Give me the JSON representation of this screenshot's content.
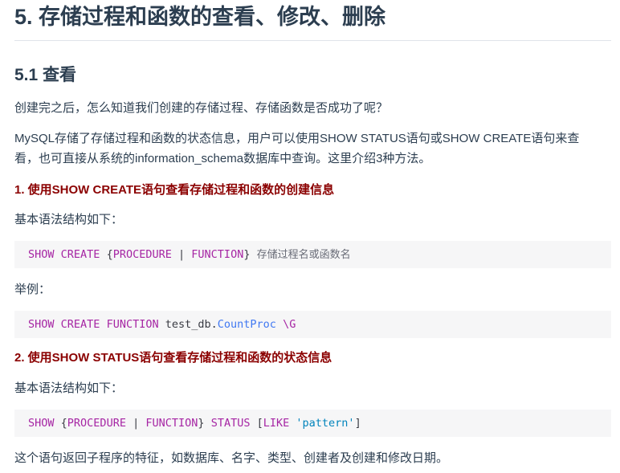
{
  "heading1": "5. 存储过程和函数的查看、修改、删除",
  "heading2": "5.1 查看",
  "intro_question": "创建完之后，怎么知道我们创建的存储过程、存储函数是否成功了呢？",
  "intro_line1": "MySQL存储了存储过程和函数的状态信息，用户可以使用SHOW STATUS语句或SHOW CREATE语句来查",
  "intro_line2": "看，也可直接从系统的information_schema数据库中查询。这里介绍3种方法。",
  "method1": {
    "title": "1. 使用SHOW CREATE语句查看存储过程和函数的创建信息",
    "syntax_label": "基本语法结构如下：",
    "syntax_code": {
      "kw1": "SHOW",
      "kw2": "CREATE",
      "open": "{",
      "kw3": "PROCEDURE",
      "sep": "|",
      "kw4": "FUNCTION",
      "close": "}",
      "comment": "存储过程名或函数名"
    },
    "example_label": "举例：",
    "example_code": {
      "kw1": "SHOW",
      "kw2": "CREATE",
      "kw3": "FUNCTION",
      "db": "test_db.",
      "name": "CountProc",
      "tail": "\\G"
    }
  },
  "method2": {
    "title": "2. 使用SHOW STATUS语句查看存储过程和函数的状态信息",
    "syntax_label": "基本语法结构如下：",
    "syntax_code": {
      "kw1": "SHOW",
      "open": "{",
      "kw2": "PROCEDURE",
      "sep": "|",
      "kw3": "FUNCTION",
      "close": "}",
      "kw4": "STATUS",
      "bracket_open": "[",
      "kw5": "LIKE",
      "pattern": "'pattern'",
      "bracket_close": "]"
    },
    "description": "这个语句返回子程序的特征，如数据库、名字、类型、创建者及创建和修改日期。"
  }
}
